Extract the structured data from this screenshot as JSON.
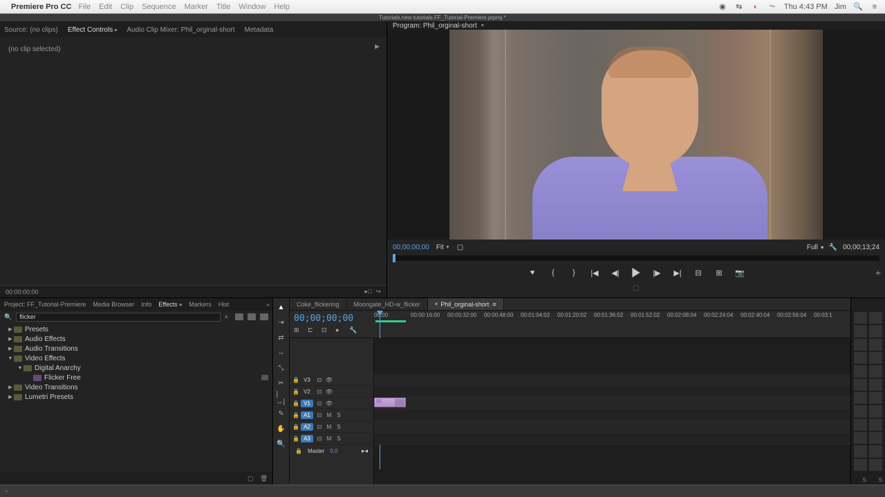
{
  "mac_menu": {
    "app": "Premiere Pro CC",
    "items": [
      "File",
      "Edit",
      "Clip",
      "Sequence",
      "Marker",
      "Title",
      "Window",
      "Help"
    ],
    "clock": "Thu 4:43 PM",
    "user": "Jim"
  },
  "doc_title": "Tutorials.new tutorials.FF_Tutorial-Premiere.prproj *",
  "source_tabs": {
    "source": "Source: (no clips)",
    "effect_controls": "Effect Controls",
    "audio_mixer": "Audio Clip Mixer: Phil_orginal-short",
    "metadata": "Metadata"
  },
  "source_body": "(no clip selected)",
  "source_tc": "00:00:00:00",
  "program": {
    "title": "Program: Phil_orginal-short",
    "tc_left": "00;00;00;00",
    "fit": "Fit",
    "full": "Full",
    "tc_right": "00;00;13;24"
  },
  "project_tabs": {
    "project": "Project: FF_Tutorial-Premiere",
    "media": "Media Browser",
    "info": "Info",
    "effects": "Effects",
    "markers": "Markers",
    "history": "Hist"
  },
  "search": {
    "value": "flicker"
  },
  "tree": {
    "presets": "Presets",
    "audio_fx": "Audio Effects",
    "audio_tr": "Audio Transitions",
    "video_fx": "Video Effects",
    "digital_anarchy": "Digital Anarchy",
    "flicker_free": "Flicker Free",
    "video_tr": "Video Transitions",
    "lumetri": "Lumetri Presets"
  },
  "sequence_tabs": {
    "tab1": "Coke_flickering",
    "tab2": "Moongate_HD-w_flicker",
    "tab3": "Phil_orginal-short"
  },
  "timeline": {
    "tc": "00;00;00;00",
    "ruler": [
      "00;00",
      "00:00:16:00",
      "00:00:32:00",
      "00:00:48:00",
      "00:01:04:02",
      "00:01:20:02",
      "00:01:36:02",
      "00:01:52:02",
      "00:02:08:04",
      "00:02:24:04",
      "00:02:40:04",
      "00:02:56:04",
      "00:03:1"
    ],
    "tracks": {
      "v3": "V3",
      "v2": "V2",
      "v1": "V1",
      "a1": "A1",
      "a2": "A2",
      "a3": "A3",
      "master": "Master",
      "master_val": "0.0"
    },
    "toggles": {
      "m": "M",
      "s": "S"
    }
  },
  "meter_footer": {
    "s1": "S",
    "s2": "S"
  }
}
